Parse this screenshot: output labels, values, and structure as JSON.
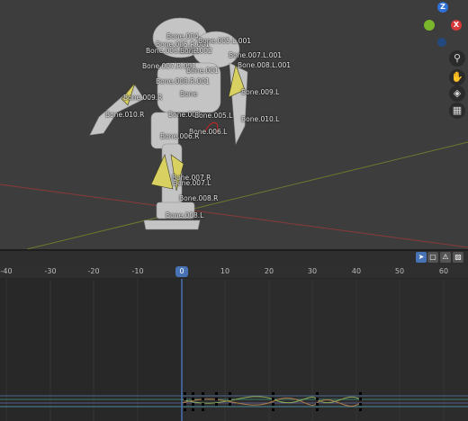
{
  "viewport": {
    "bone_labels": [
      "Bone.004",
      "Bone.005.R.001",
      "Bone.005.L.001",
      "Bone.006.R.001",
      "Bone.002",
      "Bone.007.L.001",
      "Bone.007.R.001",
      "Bone.001",
      "Bone.008.L.001",
      "Bone.008.R.001",
      "Bone.009.L",
      "Bone.009.R",
      "Bone",
      "Bone.010.R",
      "Bone.003",
      "Bone.005.L",
      "Bone.010.L",
      "Bone.006.L",
      "Bone.006.R",
      "Bone.007.R",
      "Bone.007.L",
      "Bone.008.R",
      "Bone.008.L"
    ],
    "gizmo": {
      "z": "Z",
      "x": "X"
    },
    "nav_icons": [
      "zoom-icon",
      "hand-pan-icon",
      "camera-icon",
      "grid-icon"
    ]
  },
  "timeline": {
    "ruler_ticks": [
      "-40",
      "-30",
      "-20",
      "-10",
      "0",
      "10",
      "20",
      "30",
      "40",
      "50",
      "60"
    ],
    "current_frame": "0",
    "header_icons": [
      "select-arrow-icon",
      "normalize-icon",
      "warning-icon",
      "filter-icon"
    ],
    "colors": {
      "accent": "#4772b3",
      "keyframe": "#000000"
    }
  }
}
